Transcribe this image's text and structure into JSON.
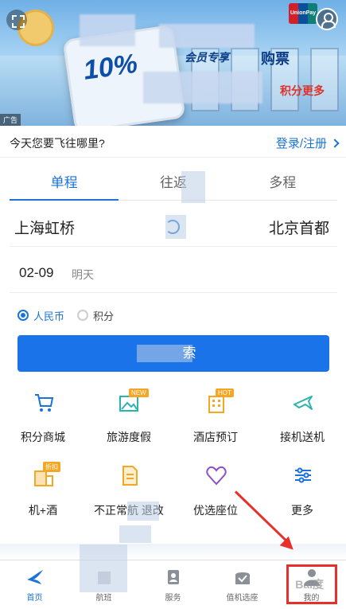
{
  "banner": {
    "ad_tag": "广告",
    "promo_line1": "会员专享",
    "promo_pct": "10%",
    "promo_line2": "购票",
    "promo_line3": "积分更多",
    "unionpay": "UnionPay"
  },
  "destination": {
    "question": "今天您要飞往哪里?",
    "login_label": "登录/注册"
  },
  "tabs": [
    {
      "label": "单程",
      "active": true
    },
    {
      "label": "往返",
      "active": false
    },
    {
      "label": "多程",
      "active": false
    }
  ],
  "route": {
    "from": "上海虹桥",
    "to": "北京首都"
  },
  "date": {
    "value": "02-09",
    "relative": "明天"
  },
  "payment": {
    "options": [
      {
        "label": "人民币",
        "selected": true
      },
      {
        "label": "积分",
        "selected": false
      }
    ]
  },
  "search": {
    "label": "索"
  },
  "services": [
    {
      "label": "积分商城",
      "icon": "cart-icon"
    },
    {
      "label": "旅游度假",
      "icon": "image-icon",
      "badge": "NEW"
    },
    {
      "label": "酒店预订",
      "icon": "hotel-icon",
      "badge": "HOT"
    },
    {
      "label": "接机送机",
      "icon": "plane-icon"
    },
    {
      "label": "机+酒",
      "icon": "building-icon",
      "badge": "折扣"
    },
    {
      "label": "不正常航 退改",
      "icon": "document-icon"
    },
    {
      "label": "优选座位",
      "icon": "heart-icon"
    },
    {
      "label": "更多",
      "icon": "sliders-icon"
    }
  ],
  "nav": [
    {
      "label": "首页",
      "icon": "swallow-logo-icon",
      "active": true
    },
    {
      "label": "航班",
      "icon": "flight-icon",
      "active": false
    },
    {
      "label": "服务",
      "icon": "clipboard-icon",
      "active": false
    },
    {
      "label": "值机选座",
      "icon": "checkin-icon",
      "active": false
    },
    {
      "label": "我的",
      "icon": "user-icon",
      "active": false
    }
  ],
  "watermark": "Bai度",
  "colors": {
    "accent": "#1a73d9",
    "button": "#1a73e8",
    "annotation": "#e8302a",
    "icon_orange": "#f5a623",
    "icon_teal": "#2bb3b0",
    "icon_purple": "#8c4fc8"
  }
}
